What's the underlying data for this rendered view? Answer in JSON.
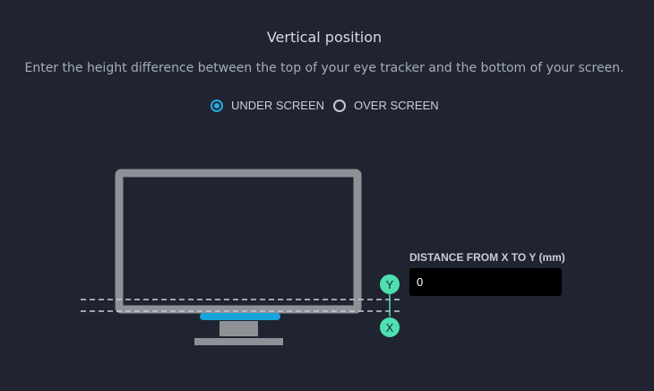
{
  "header": {
    "title": "Vertical position",
    "subtitle": "Enter the height difference between the top of your eye tracker and the bottom of your screen."
  },
  "position_options": [
    {
      "label": "UNDER SCREEN",
      "selected": true
    },
    {
      "label": "OVER SCREEN",
      "selected": false
    }
  ],
  "distance_field": {
    "label": "DISTANCE FROM X TO Y (mm)",
    "value": "0"
  },
  "markers": {
    "y_label": "Y",
    "x_label": "X"
  },
  "colors": {
    "background": "#1f2430",
    "monitor": "#8e9196",
    "tracker_bar": "#17a3dc",
    "marker": "#4fe0b0",
    "radio_active": "#27a9e1"
  }
}
